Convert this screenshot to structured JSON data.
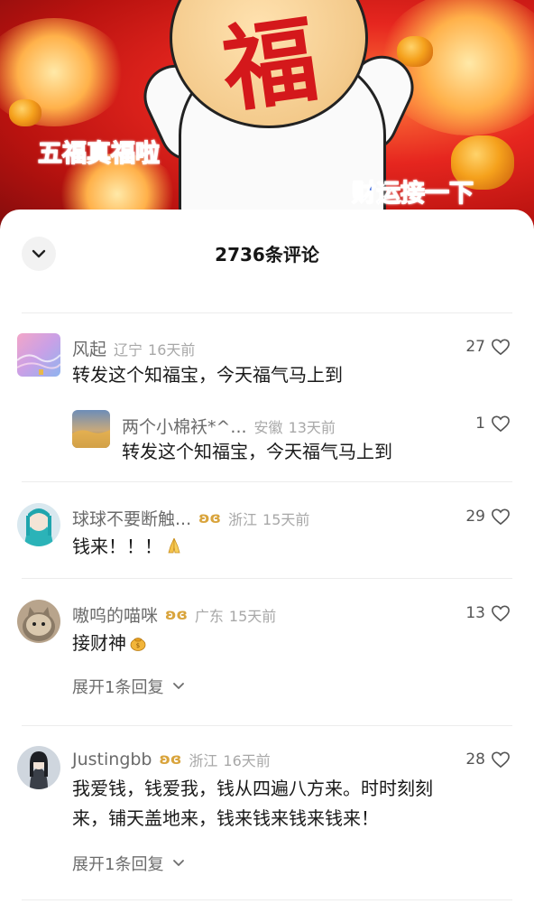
{
  "banner": {
    "caption_left": "五福真福啦",
    "caption_right": "财运接一下",
    "center_glyph": "福"
  },
  "sheet": {
    "title": "2736条评论"
  },
  "comments": [
    {
      "user": "风起",
      "location": "辽宁",
      "time": "16天前",
      "text": "转发这个知福宝，今天福气马上到",
      "likes": "27",
      "reply": {
        "user": "两个小棉袄*^...",
        "location": "安徽",
        "time": "13天前",
        "text": "转发这个知福宝，今天福气马上到",
        "likes": "1"
      }
    },
    {
      "user": "球球不要断触...",
      "badge": "ʚɞ",
      "location": "浙江",
      "time": "15天前",
      "text": "钱来！！！",
      "emoji": "praying-hands",
      "likes": "29"
    },
    {
      "user": "嗷呜的喵咪",
      "badge": "ʚɞ",
      "location": "广东",
      "time": "15天前",
      "text": "接财神",
      "emoji": "money-bag",
      "likes": "13",
      "expand": "展开1条回复"
    },
    {
      "user": "Justingbb",
      "badge": "ʚɞ",
      "location": "浙江",
      "time": "16天前",
      "text_line1": "我爱钱，钱爱我，钱从四遍八方来。时时刻刻",
      "text_line2": "来，铺天盖地来，钱来钱来钱来钱来！",
      "likes": "28",
      "expand": "展开1条回复"
    }
  ],
  "colors": {
    "accent_badge": "#d9a43c",
    "caption_blue": "#1b4fd8",
    "banner_red": "#e6261f"
  },
  "icons": {
    "collapse": "chevron-down-icon",
    "like": "heart-outline-icon",
    "expand": "chevron-down-icon"
  }
}
